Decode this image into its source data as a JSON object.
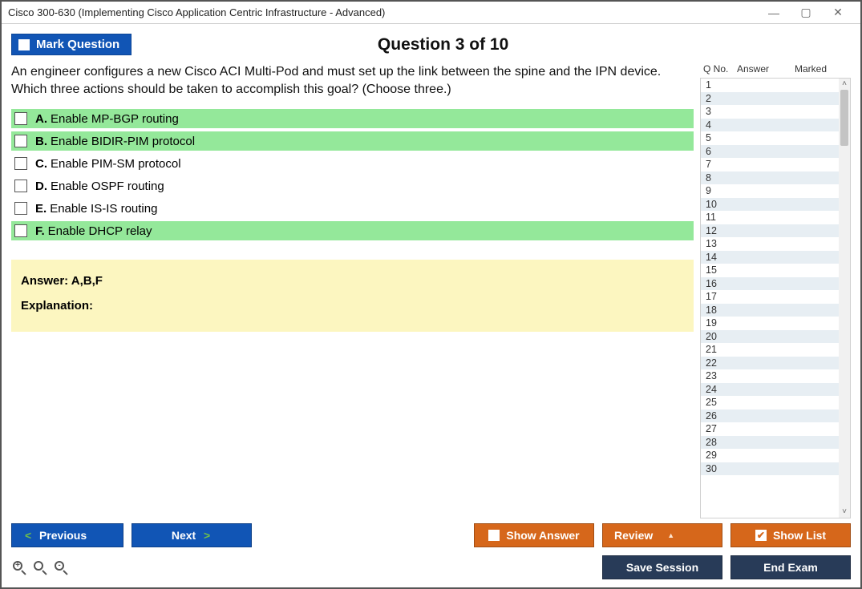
{
  "window": {
    "title": "Cisco 300-630 (Implementing Cisco Application Centric Infrastructure - Advanced)"
  },
  "topbar": {
    "mark_label": "Mark Question",
    "question_title": "Question 3 of 10"
  },
  "question": {
    "text": "An engineer configures a new Cisco ACI Multi-Pod and must set up the link between the spine and the IPN device. Which three actions should be taken to accomplish this goal? (Choose three.)"
  },
  "options": [
    {
      "letter": "A.",
      "text": "Enable MP-BGP routing",
      "correct": true
    },
    {
      "letter": "B.",
      "text": "Enable BIDIR-PIM protocol",
      "correct": true
    },
    {
      "letter": "C.",
      "text": "Enable PIM-SM protocol",
      "correct": false
    },
    {
      "letter": "D.",
      "text": "Enable OSPF routing",
      "correct": false
    },
    {
      "letter": "E.",
      "text": "Enable IS-IS routing",
      "correct": false
    },
    {
      "letter": "F.",
      "text": "Enable DHCP relay",
      "correct": true
    }
  ],
  "answer": {
    "line": "Answer: A,B,F",
    "explanation_label": "Explanation:"
  },
  "sidebar": {
    "headers": {
      "qno": "Q No.",
      "answer": "Answer",
      "marked": "Marked"
    },
    "rows": 30
  },
  "buttons": {
    "previous": "Previous",
    "next": "Next",
    "show_answer": "Show Answer",
    "review": "Review",
    "show_list": "Show List",
    "save_session": "Save Session",
    "end_exam": "End Exam"
  }
}
